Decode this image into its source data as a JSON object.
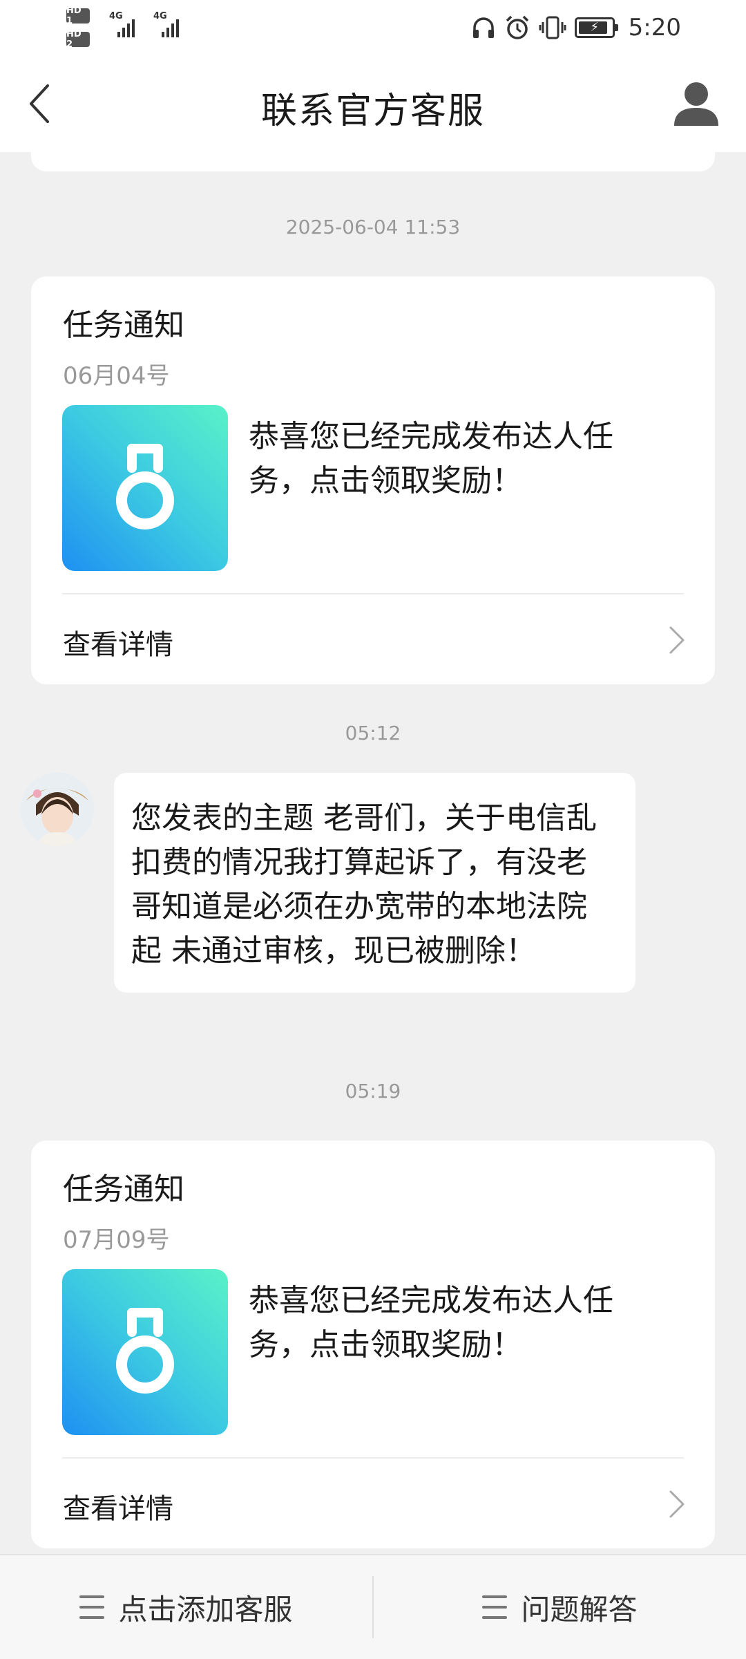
{
  "status_bar": {
    "time": "5:20",
    "sim1_badge": "HD 1",
    "sim2_badge": "HD 2",
    "net1": "4G",
    "net2": "4G",
    "battery_level": 0.9,
    "icons": [
      "headphones-icon",
      "alarm-icon",
      "vibrate-icon",
      "battery-charging-icon"
    ]
  },
  "header": {
    "title": "联系官方客服",
    "back_icon": "chevron-left-icon",
    "profile_icon": "user-profile-icon"
  },
  "messages": [
    {
      "timestamp": "2025-06-04 11:53",
      "type": "task_card",
      "title": "任务通知",
      "date": "06月04号",
      "thumbnail_icon": "medal-icon",
      "body": "恭喜您已经完成发布达人任务，点击领取奖励！",
      "detail_label": "查看详情"
    },
    {
      "timestamp": "05:12",
      "type": "text",
      "avatar_icon": "avatar-image",
      "body": "您发表的主题 老哥们，关于电信乱扣费的情况我打算起诉了，有没老哥知道是必须在办宽带的本地法院起 未通过审核，现已被删除！"
    },
    {
      "timestamp": "05:19",
      "type": "task_card",
      "title": "任务通知",
      "date": "07月09号",
      "thumbnail_icon": "medal-icon",
      "body": "恭喜您已经完成发布达人任务，点击领取奖励！",
      "detail_label": "查看详情"
    }
  ],
  "bottom_bar": {
    "tabs": [
      {
        "label": "点击添加客服",
        "icon": "menu-icon"
      },
      {
        "label": "问题解答",
        "icon": "menu-icon"
      }
    ]
  },
  "colors": {
    "background": "#f0f0f0",
    "card": "#ffffff",
    "muted_text": "#999999",
    "thumb_gradient_start": "#1e90f2",
    "thumb_gradient_end": "#59f2c8"
  }
}
